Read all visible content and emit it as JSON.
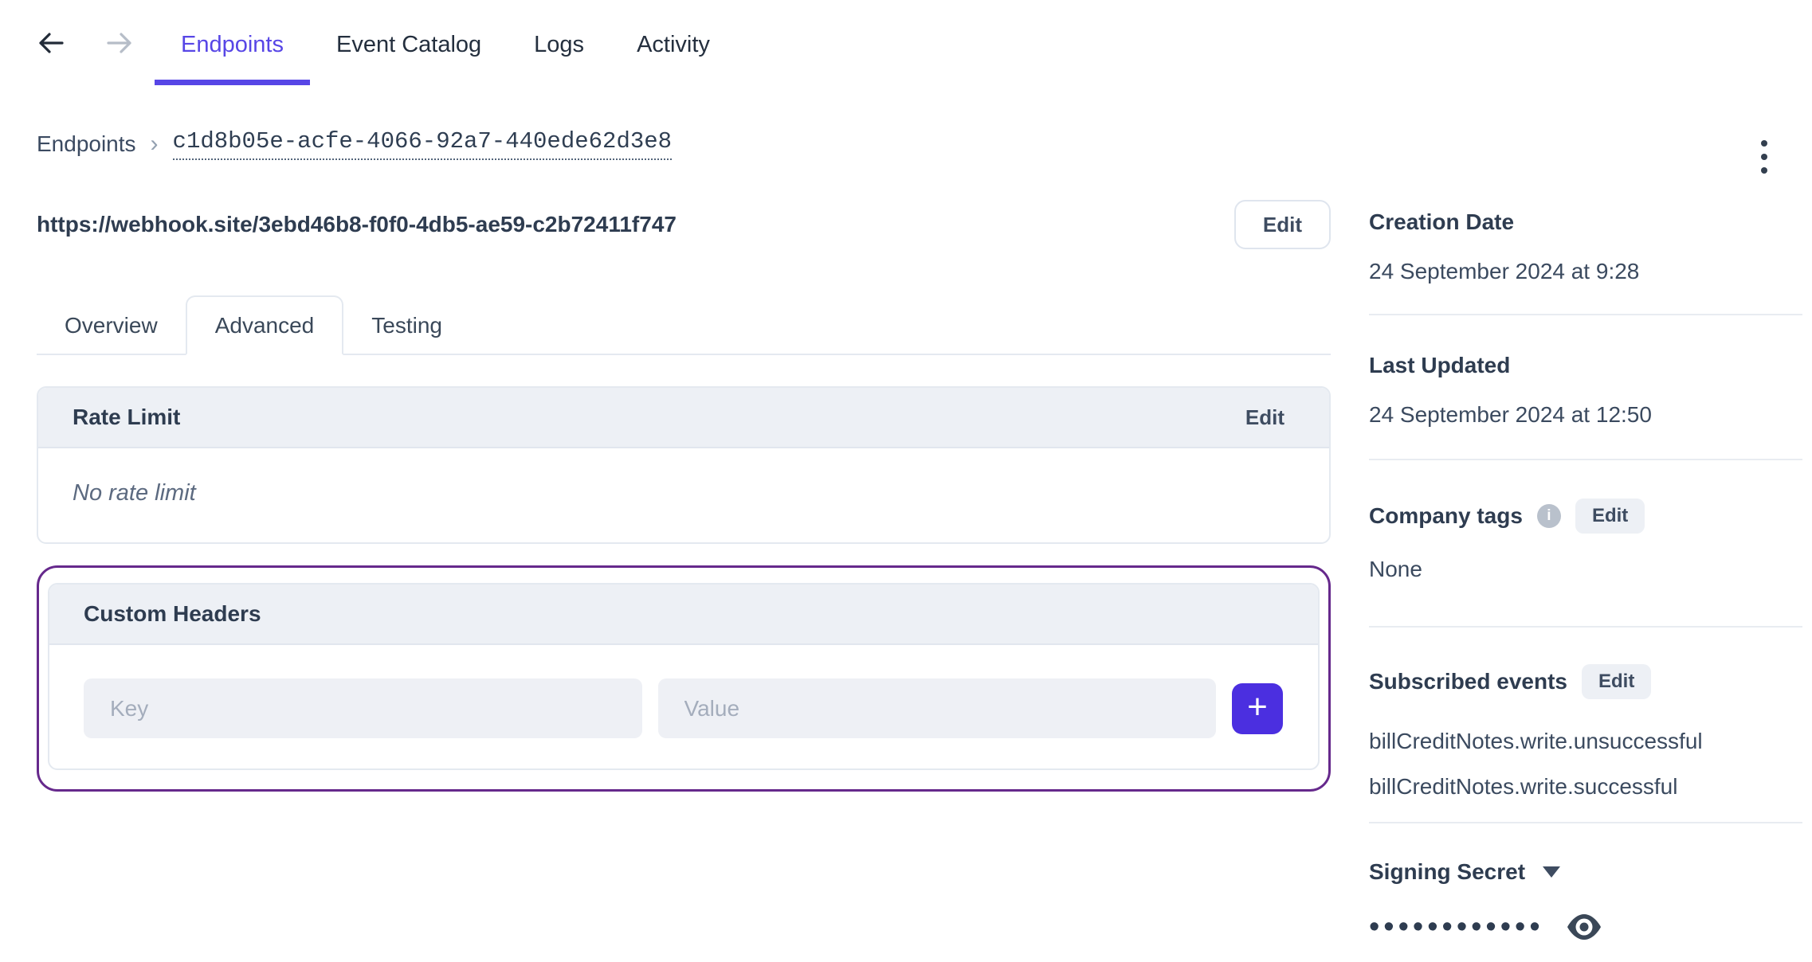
{
  "topnav": {
    "endpoints": "Endpoints",
    "event_catalog": "Event Catalog",
    "logs": "Logs",
    "activity": "Activity"
  },
  "breadcrumb": {
    "root": "Endpoints",
    "separator": "›",
    "current": "c1d8b05e-acfe-4066-92a7-440ede62d3e8"
  },
  "endpoint": {
    "url": "https://webhook.site/3ebd46b8-f0f0-4db5-ae59-c2b72411f747",
    "edit_label": "Edit"
  },
  "detail_tabs": {
    "overview": "Overview",
    "advanced": "Advanced",
    "testing": "Testing"
  },
  "rate_limit": {
    "title": "Rate Limit",
    "edit_label": "Edit",
    "empty_text": "No rate limit"
  },
  "custom_headers": {
    "title": "Custom Headers",
    "key_placeholder": "Key",
    "value_placeholder": "Value",
    "add_label": "+"
  },
  "sidebar": {
    "creation_date": {
      "label": "Creation Date",
      "value": "24 September 2024 at 9:28"
    },
    "last_updated": {
      "label": "Last Updated",
      "value": "24 September 2024 at 12:50"
    },
    "company_tags": {
      "label": "Company tags",
      "info_icon": "info-icon",
      "edit_label": "Edit",
      "value": "None"
    },
    "subscribed_events": {
      "label": "Subscribed events",
      "edit_label": "Edit",
      "events": [
        "billCreditNotes.write.unsuccessful",
        "billCreditNotes.write.successful"
      ]
    },
    "signing_secret": {
      "label": "Signing Secret",
      "masked_value": "••••••••••••"
    }
  },
  "icons": {
    "back": "arrow-left-icon",
    "forward": "arrow-right-icon",
    "menu": "kebab-menu-icon",
    "info": "info-icon",
    "caret": "chevron-down-icon",
    "reveal": "eye-icon"
  },
  "colors": {
    "accent_purple": "#5746e6",
    "add_button_purple": "#4b2fe0",
    "highlight_outline_purple": "#66298c",
    "card_header_bg": "#edf0f5",
    "text_dark": "#2e3c50"
  }
}
